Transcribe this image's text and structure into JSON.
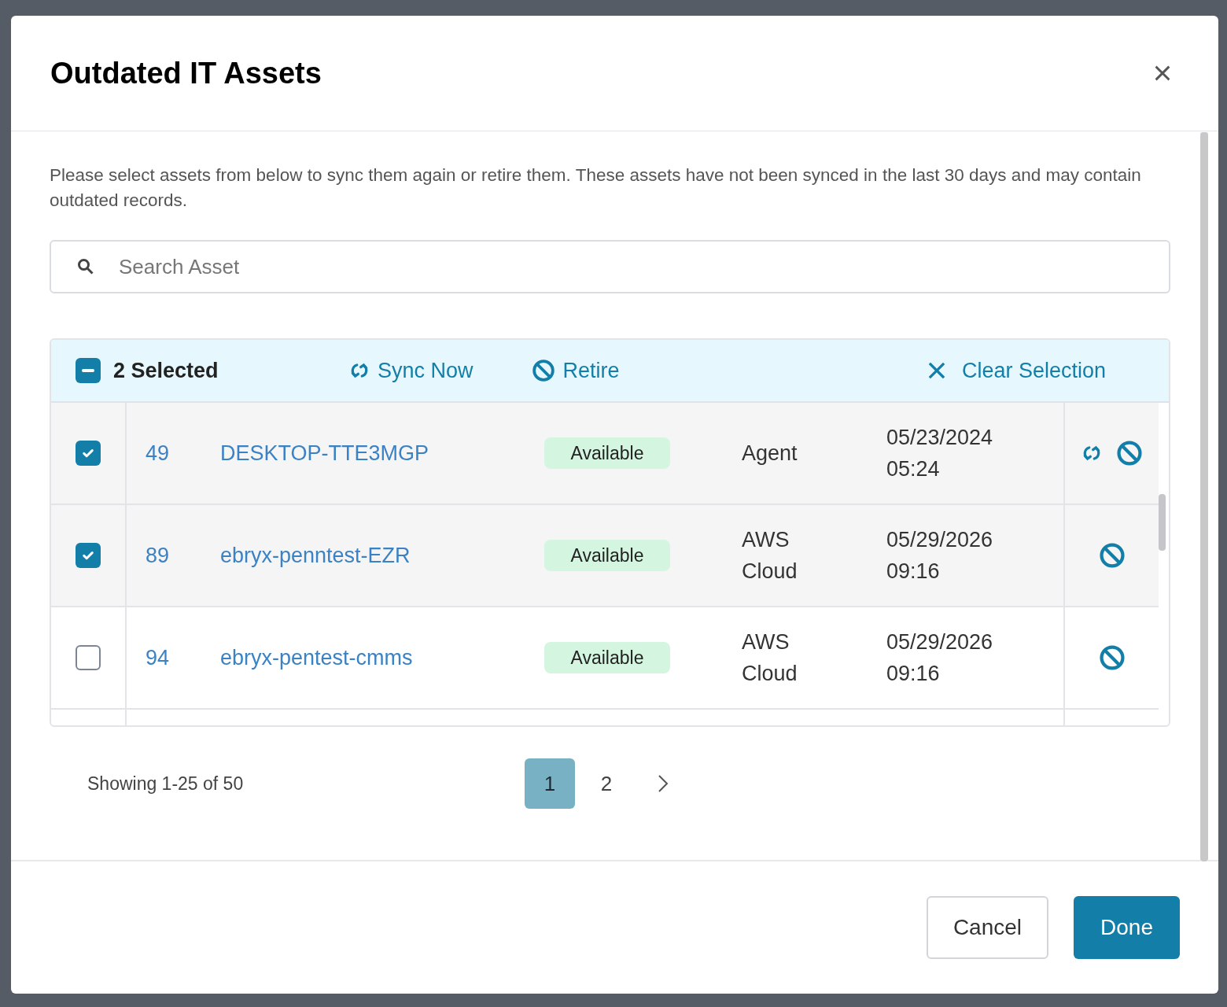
{
  "dialog": {
    "title": "Outdated IT Assets",
    "description": "Please select assets from below to sync them again or retire them. These assets have not been synced in the last 30 days and may contain outdated records.",
    "search": {
      "placeholder": "Search Asset"
    }
  },
  "selection_bar": {
    "count_label": "2 Selected",
    "indeterminate": true,
    "actions": [
      {
        "kind": "sync",
        "label": "Sync Now"
      },
      {
        "kind": "retire",
        "label": "Retire"
      }
    ],
    "clear_label": "Clear Selection"
  },
  "rows": [
    {
      "selected": true,
      "id": "49",
      "name": "DESKTOP-TTE3MGP",
      "status": "Available",
      "source": "Agent",
      "last_synced": [
        "05/23/2024",
        "05:24"
      ],
      "can_sync": true,
      "can_retire": true
    },
    {
      "selected": true,
      "id": "89",
      "name": "ebryx-penntest-EZR",
      "status": "Available",
      "source": "AWS Cloud",
      "last_synced": [
        "05/29/2026",
        "09:16"
      ],
      "can_sync": false,
      "can_retire": true
    },
    {
      "selected": false,
      "id": "94",
      "name": "ebryx-pentest-cmms",
      "status": "Available",
      "source": "AWS Cloud",
      "last_synced": [
        "05/29/2026",
        "09:16"
      ],
      "can_sync": false,
      "can_retire": true
    }
  ],
  "pagination": {
    "summary": "Showing 1-25 of 50",
    "pages": [
      {
        "label": "1",
        "selected": true
      },
      {
        "label": "2",
        "selected": false
      }
    ]
  },
  "footer": {
    "buttons": [
      {
        "kind": "secondary",
        "label": "Cancel"
      },
      {
        "kind": "primary",
        "label": "Done"
      }
    ]
  }
}
